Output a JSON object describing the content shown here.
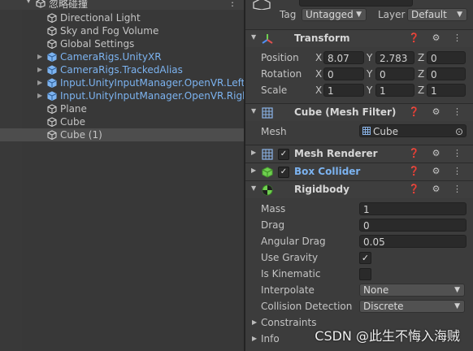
{
  "hierarchy": {
    "scene_name": "忽略碰撞",
    "items": [
      {
        "label": "Directional Light",
        "prefab": false,
        "foldable": false,
        "selected": false
      },
      {
        "label": "Sky and Fog Volume",
        "prefab": false,
        "foldable": false,
        "selected": false
      },
      {
        "label": "Global Settings",
        "prefab": false,
        "foldable": false,
        "selected": false
      },
      {
        "label": "CameraRigs.UnityXR",
        "prefab": true,
        "foldable": true,
        "selected": false
      },
      {
        "label": "CameraRigs.TrackedAlias",
        "prefab": true,
        "foldable": true,
        "selected": false
      },
      {
        "label": "Input.UnityInputManager.OpenVR.LeftCo",
        "prefab": true,
        "foldable": true,
        "selected": false
      },
      {
        "label": "Input.UnityInputManager.OpenVR.RightC",
        "prefab": true,
        "foldable": true,
        "selected": false
      },
      {
        "label": "Plane",
        "prefab": false,
        "foldable": false,
        "selected": false
      },
      {
        "label": "Cube",
        "prefab": false,
        "foldable": false,
        "selected": false
      },
      {
        "label": "Cube (1)",
        "prefab": false,
        "foldable": false,
        "selected": true
      }
    ]
  },
  "inspector": {
    "tag_label": "Tag",
    "tag_value": "Untagged",
    "layer_label": "Layer",
    "layer_value": "Default",
    "transform": {
      "title": "Transform",
      "position_label": "Position",
      "rotation_label": "Rotation",
      "scale_label": "Scale",
      "axis_x": "X",
      "axis_y": "Y",
      "axis_z": "Z",
      "position": {
        "x": "8.07",
        "y": "2.783",
        "z": "0"
      },
      "rotation": {
        "x": "0",
        "y": "0",
        "z": "0"
      },
      "scale": {
        "x": "1",
        "y": "1",
        "z": "1"
      }
    },
    "mesh_filter": {
      "title": "Cube (Mesh Filter)",
      "mesh_label": "Mesh",
      "mesh_value": "Cube"
    },
    "mesh_renderer": {
      "title": "Mesh Renderer",
      "enabled": true
    },
    "box_collider": {
      "title": "Box Collider",
      "enabled": true
    },
    "rigidbody": {
      "title": "Rigidbody",
      "mass_label": "Mass",
      "mass": "1",
      "drag_label": "Drag",
      "drag": "0",
      "angular_drag_label": "Angular Drag",
      "angular_drag": "0.05",
      "use_gravity_label": "Use Gravity",
      "use_gravity": true,
      "is_kinematic_label": "Is Kinematic",
      "is_kinematic": false,
      "interpolate_label": "Interpolate",
      "interpolate": "None",
      "collision_detection_label": "Collision Detection",
      "collision_detection": "Discrete",
      "constraints_label": "Constraints",
      "info_label": "Info"
    },
    "header_icons": "❓ ⚙ ⋮"
  },
  "watermark": "CSDN @此生不悔入海贼",
  "colors": {
    "background": "#383838",
    "inspector_bg": "#3c3c3c",
    "prefab_blue": "#7cb3f0",
    "selection": "#4d4d4d",
    "field_bg": "#2a2a2a"
  }
}
